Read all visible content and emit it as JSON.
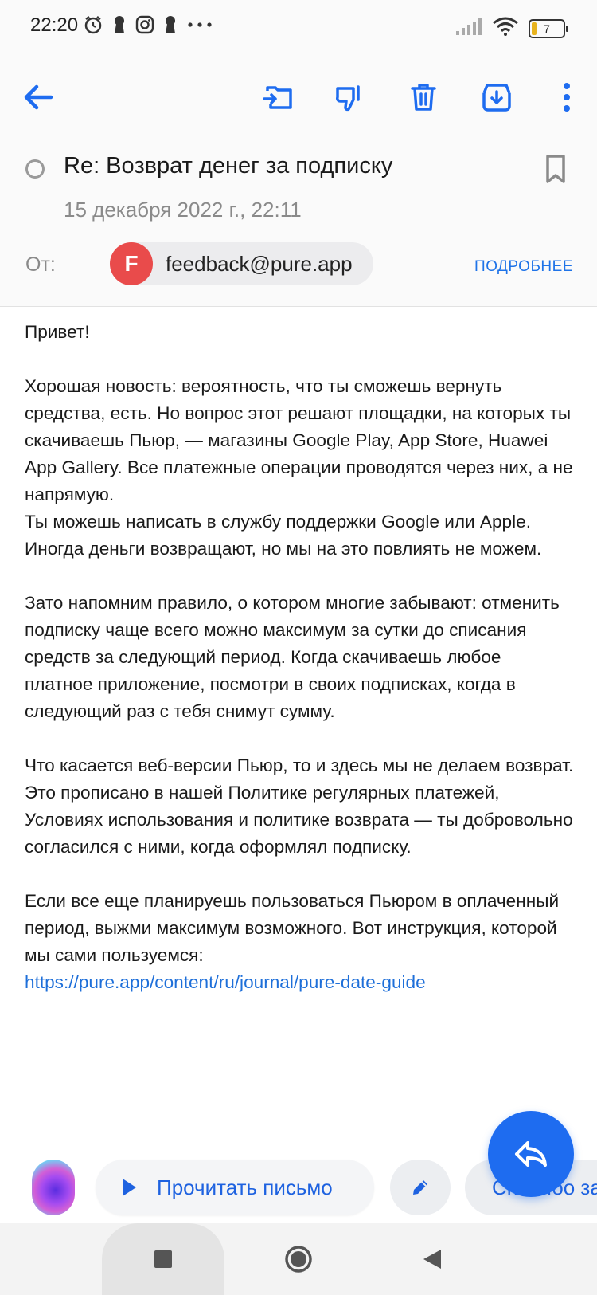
{
  "status": {
    "time": "22:20",
    "battery": "7"
  },
  "colors": {
    "accent": "#1e6cf0",
    "avatar": "#e94b4b",
    "link": "#1e6fd9"
  },
  "toolbar": {
    "icons": [
      "back-arrow-icon",
      "move-to-folder-icon",
      "spam-dislike-icon",
      "trash-icon",
      "download-icon",
      "more-vertical-icon"
    ]
  },
  "email": {
    "subject": "Re: Возврат денег за подписку",
    "date": "15 декабря 2022 г., 22:11",
    "from_label": "От:",
    "sender_initial": "F",
    "sender_email": "feedback@pure.app",
    "details_link": "ПОДРОБНЕЕ",
    "body": {
      "greeting": "Привет!",
      "p1": "Хорошая новость: вероятность, что ты сможешь вернуть средства, есть. Но вопрос этот решают площадки, на которых ты скачиваешь Пьюр, — магазины Google Play, App Store, Huawei App Gallery. Все платежные операции проводятся через них, а не напрямую.",
      "p2": "Ты можешь написать в службу поддержки Google или Apple. Иногда деньги возвращают, но мы на это повлиять не можем.",
      "p3": "Зато напомним правило, о котором многие забывают: отменить подписку чаще всего можно максимум за сутки до списания средств за следующий период. Когда скачиваешь любое платное приложение, посмотри в своих подписках, когда в следующий раз с тебя снимут сумму.",
      "p4": "Что касается веб-версии Пьюр, то и здесь мы не делаем возврат. Это прописано в нашей Политике регулярных платежей, Условиях использования и политике возврата — ты добровольно согласился с ними, когда оформлял подписку.",
      "p5": "Если все еще планируешь пользоваться Пьюром в оплаченный период, выжми максимум возможного. Вот инструкция, которой мы сами пользуемся:",
      "link": "https://pure.app/content/ru/journal/pure-date-guide"
    }
  },
  "actions": {
    "read_aloud": "Прочитать письмо",
    "suggest": "Спасибо за"
  }
}
